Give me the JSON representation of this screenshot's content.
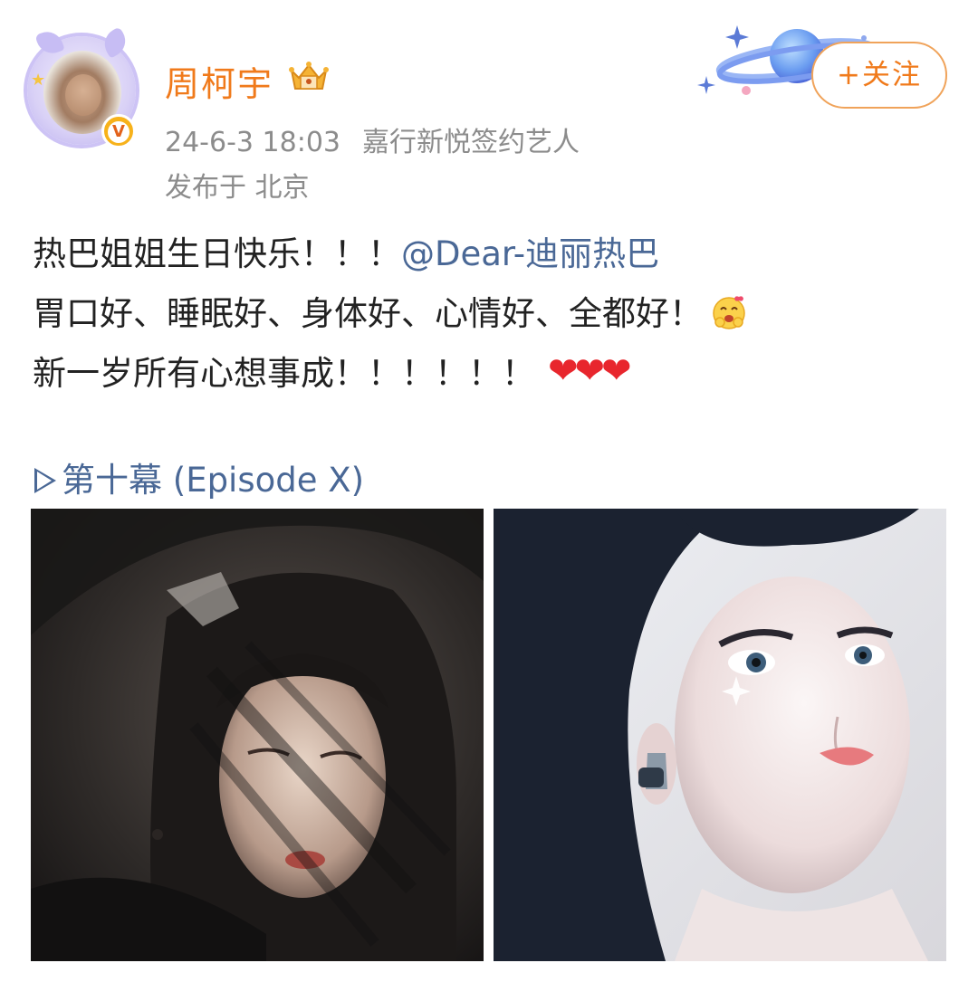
{
  "user": {
    "name": "周柯宇",
    "timestamp": "24-6-3 18:03",
    "source": "嘉行新悦签约艺人",
    "location": "发布于 北京",
    "verified_badge": "V",
    "follow_label": "+关注"
  },
  "post": {
    "line1_text": "热巴姐姐生日快乐！！！",
    "line1_mention": "@Dear-迪丽热巴",
    "line2_text": "胃口好、睡眠好、身体好、心情好、全都好！",
    "line2_emoji": "hug-face-emoji",
    "line3_text": "新一岁所有心想事成！！！！！！",
    "line3_hearts": [
      "❤",
      "❤",
      "❤"
    ],
    "episode_link": "第十幕 (Episode X)"
  },
  "colors": {
    "name": "#f07a1b",
    "meta": "#8c8c8c",
    "link": "#4a6896",
    "heart": "#e8262d",
    "follow_border": "#f0a35a",
    "badge": "#f7b21b"
  },
  "icons": {
    "vip": "crown-badge-icon",
    "verified": "verified-v-icon",
    "decoration": "planet-decoration",
    "episode": "play-triangle-icon"
  },
  "images": [
    {
      "name": "photo-dark-veil-portrait"
    },
    {
      "name": "photo-light-portrait"
    }
  ]
}
